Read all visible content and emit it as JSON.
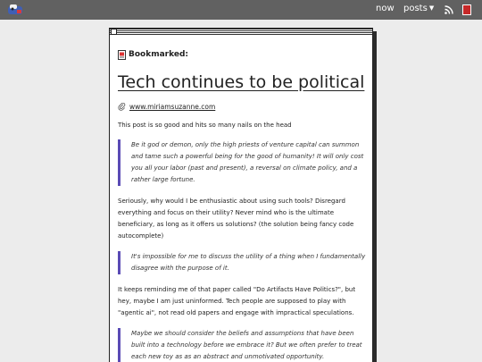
{
  "nav": {
    "now_label": "now",
    "posts_label": "posts",
    "posts_caret": "▼",
    "icons": [
      "logo-icon",
      "rss-icon",
      "bookmark-icon"
    ],
    "accent_color": "#c62828"
  },
  "post": {
    "kicker": "Bookmarked:",
    "title": "Tech continues to be political",
    "source_link": "www.miriamsuzanne.com",
    "intro": "This post is so good and hits so many nails on the head",
    "quote1": "Be it god or demon, only the high priests of venture capital can summon and tame such a powerful being for the good of humanity! It will only cost you all your labor (past and present), a reversal on climate policy, and a rather large fortune.",
    "para2": "Seriously, why would I be enthusiastic about using such tools? Disregard everything and focus on their utility? Never mind who is the ultimate beneficiary, as long as it offers us solutions? (the solution being fancy code autocomplete)",
    "quote2": "It's impossible for me to discuss the utility of a thing when I fundamentally disagree with the purpose of it.",
    "para3": "It keeps reminding me of that paper called \"Do Artifacts Have Politics?\", but hey, maybe I am just uninformed. Tech people are supposed to play with \"agentic ai\", not read old papers and engage with impractical speculations.",
    "quote3": "Maybe we should consider the beliefs and assumptions that have been built into a technology before we embrace it? But we often prefer to treat each new toy as as an abstract and unmotivated opportunity.",
    "quote_border_color": "#5a4bb5"
  }
}
